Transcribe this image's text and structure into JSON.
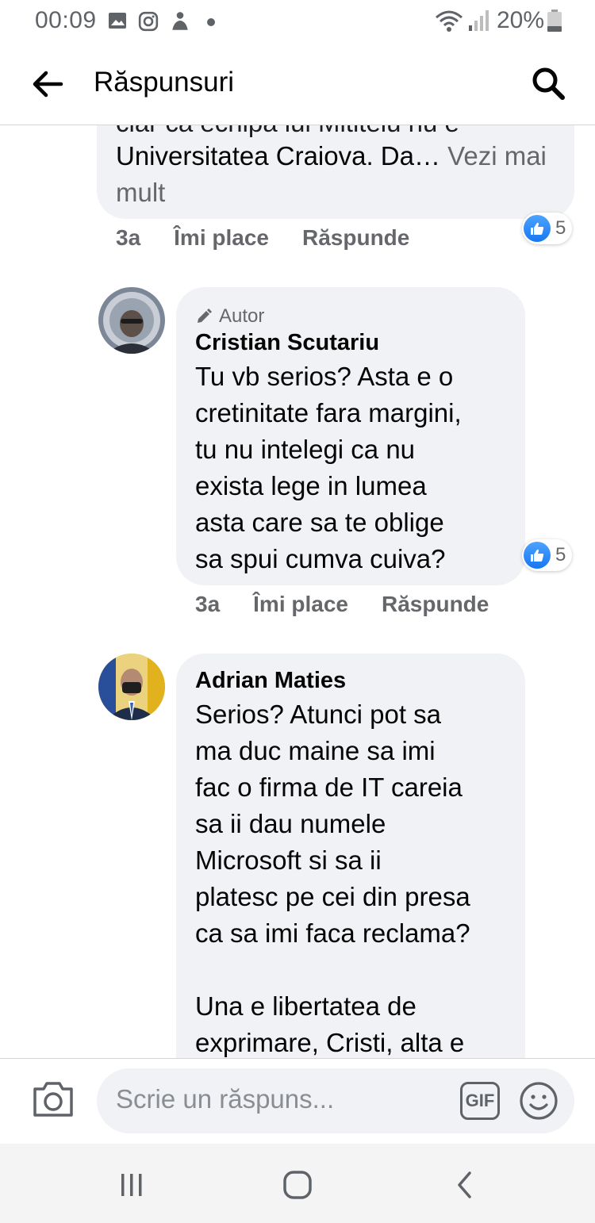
{
  "status_bar": {
    "time": "00:09",
    "battery": "20%",
    "icons": [
      "image-icon",
      "instagram-icon",
      "notification-icon",
      "dot-icon",
      "wifi-icon",
      "signal-icon",
      "battery-icon"
    ]
  },
  "header": {
    "title": "Răspunsuri",
    "back_icon": "arrow-left-icon",
    "search_icon": "search-icon"
  },
  "comments": [
    {
      "partial": true,
      "text": "Universitatea Craiova. Da…",
      "see_more": "Vezi mai mult",
      "time": "3a",
      "like_label": "Îmi place",
      "reply_label": "Răspunde",
      "reactions": "5"
    },
    {
      "badge": "Autor",
      "name": "Cristian Scutariu",
      "lines": [
        "Tu vb serios? Asta e o",
        "cretinitate fara margini,",
        "tu nu intelegi ca nu",
        "exista lege in lumea",
        "asta care sa te oblige",
        "sa spui cumva cuiva?"
      ],
      "time": "3a",
      "like_label": "Îmi place",
      "reply_label": "Răspunde",
      "reactions": "5"
    },
    {
      "name": "Adrian Maties",
      "lines": [
        "Serios? Atunci pot sa",
        "ma duc maine sa imi",
        "fac o firma de IT careia",
        "sa ii dau numele",
        "Microsoft si sa ii",
        "platesc pe cei din presa",
        "ca sa imi faca reclama?",
        "",
        "Una e libertatea de",
        "exprimare, Cristi, alta e"
      ]
    }
  ],
  "composer": {
    "placeholder": "Scrie un răspuns...",
    "gif_label": "GIF"
  },
  "colors": {
    "bubble": "#f0f2f5",
    "secondary_text": "#65676b",
    "like_blue": "#1877f2"
  }
}
